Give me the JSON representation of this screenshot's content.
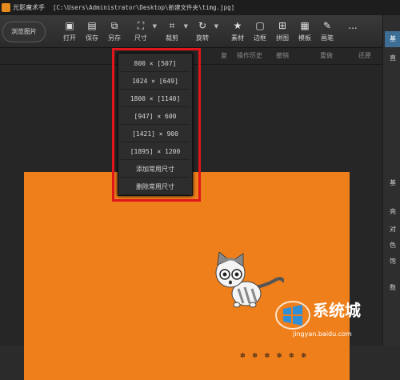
{
  "title_bar": {
    "app_name": "光影魔术手",
    "file_path": "[C:\\Users\\Administrator\\Desktop\\新建文件夹\\timg.jpg]"
  },
  "toolbar": {
    "browse_label": "浏览图片",
    "tools": [
      {
        "label": "打开",
        "icon": "open-icon"
      },
      {
        "label": "保存",
        "icon": "save-icon"
      },
      {
        "label": "另存",
        "icon": "save-as-icon"
      },
      {
        "label": "尺寸",
        "icon": "resize-icon"
      },
      {
        "label": "裁剪",
        "icon": "crop-icon"
      },
      {
        "label": "旋转",
        "icon": "rotate-icon"
      },
      {
        "label": "素材",
        "icon": "material-icon"
      },
      {
        "label": "边框",
        "icon": "border-icon"
      },
      {
        "label": "拼图",
        "icon": "collage-icon"
      },
      {
        "label": "模板",
        "icon": "template-icon"
      },
      {
        "label": "画笔",
        "icon": "brush-icon"
      },
      {
        "label": "...",
        "icon": "more-icon"
      }
    ]
  },
  "subbar": {
    "restore": "复",
    "history": "操作历史",
    "undo": "撤销",
    "redo": "重做",
    "restore_all": "还原"
  },
  "size_menu": {
    "options": [
      "800 × [507]",
      "1024 × [649]",
      "1800 × [1140]",
      "[947] × 600",
      "[1421] × 900",
      "[1895] × 1200",
      "添加常用尺寸",
      "删除常用尺寸"
    ]
  },
  "right_panel": {
    "tab": "基",
    "side_chars": [
      "直",
      "基",
      "亮",
      "对",
      "色",
      "饱",
      "数"
    ]
  },
  "watermark": {
    "text": "系统城",
    "url": "jingyan.baidu.com"
  },
  "colors": {
    "image_background": "#ee7f1b",
    "highlight": "#e0161b",
    "accent": "#3d6e96"
  }
}
